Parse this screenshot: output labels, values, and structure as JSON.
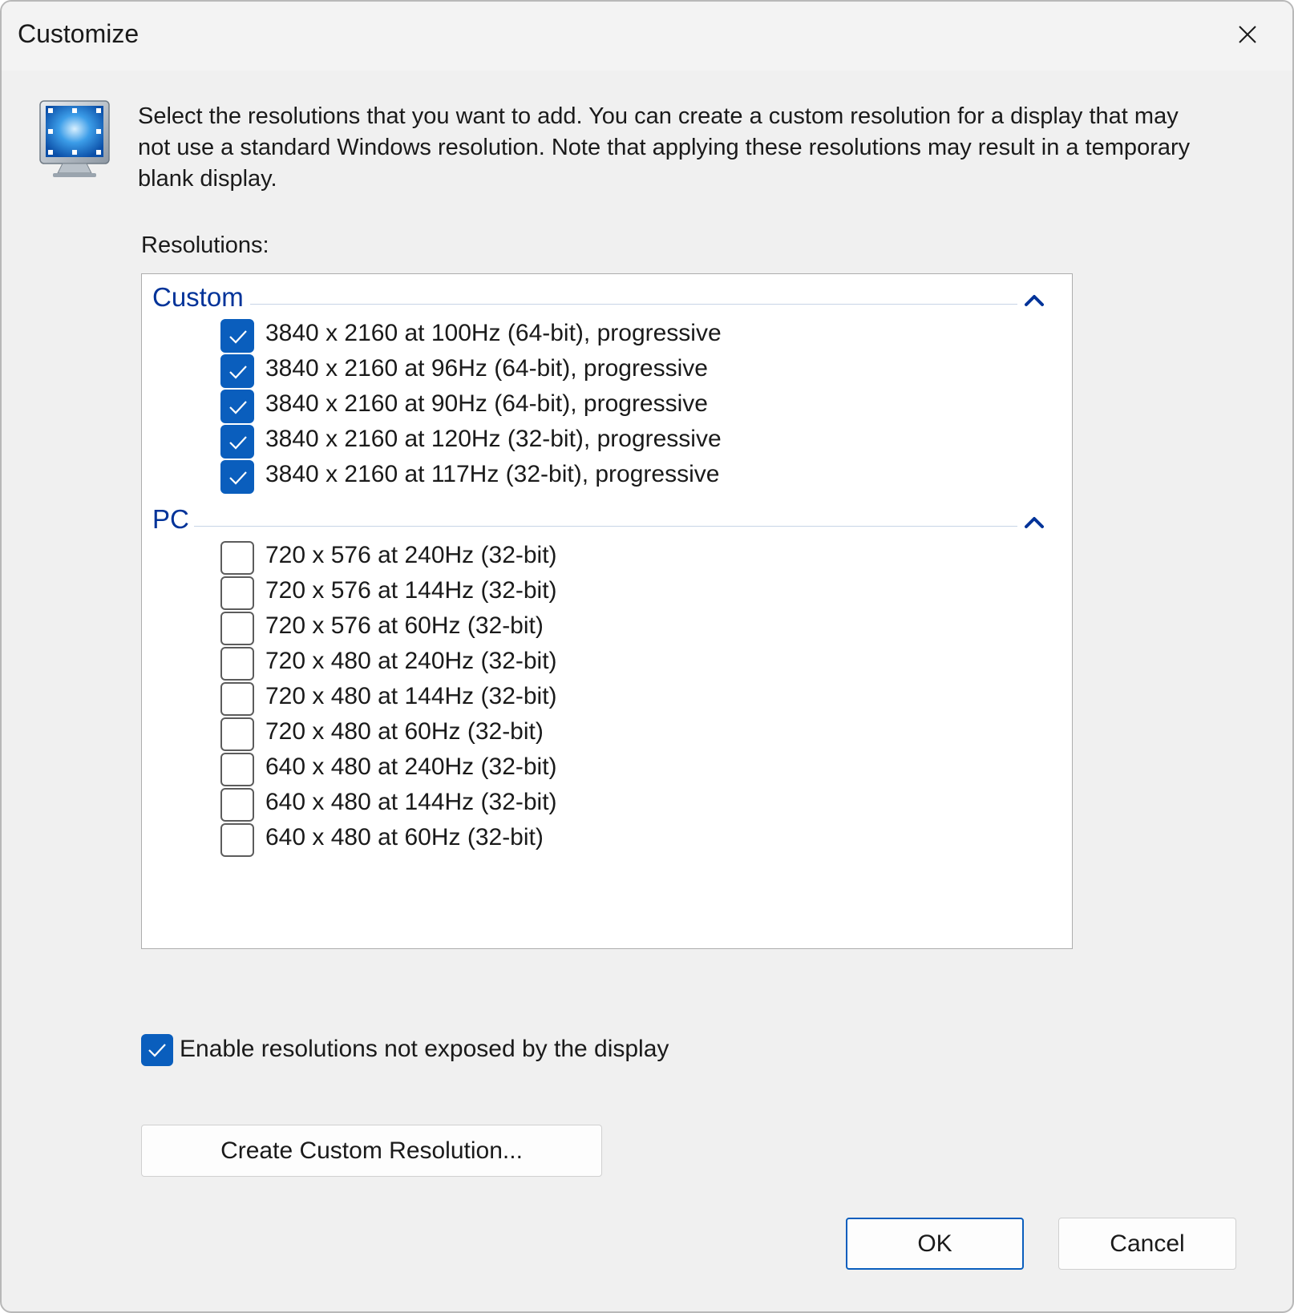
{
  "window": {
    "title": "Customize"
  },
  "description": "Select the resolutions that you want to add. You can create a custom resolution for a display that may not use a standard Windows resolution. Note that applying these resolutions may result in a temporary blank display.",
  "resolutions_label": "Resolutions:",
  "groups": [
    {
      "title": "Custom",
      "items": [
        {
          "label": "3840 x 2160 at 100Hz (64-bit), progressive",
          "checked": true
        },
        {
          "label": "3840 x 2160 at 96Hz (64-bit), progressive",
          "checked": true
        },
        {
          "label": "3840 x 2160 at 90Hz (64-bit), progressive",
          "checked": true
        },
        {
          "label": "3840 x 2160 at 120Hz (32-bit), progressive",
          "checked": true
        },
        {
          "label": "3840 x 2160 at 117Hz (32-bit), progressive",
          "checked": true
        }
      ]
    },
    {
      "title": "PC",
      "items": [
        {
          "label": "720 x 576 at 240Hz (32-bit)",
          "checked": false
        },
        {
          "label": "720 x 576 at 144Hz (32-bit)",
          "checked": false
        },
        {
          "label": "720 x 576 at 60Hz (32-bit)",
          "checked": false
        },
        {
          "label": "720 x 480 at 240Hz (32-bit)",
          "checked": false
        },
        {
          "label": "720 x 480 at 144Hz (32-bit)",
          "checked": false
        },
        {
          "label": "720 x 480 at 60Hz (32-bit)",
          "checked": false
        },
        {
          "label": "640 x 480 at 240Hz (32-bit)",
          "checked": false
        },
        {
          "label": "640 x 480 at 144Hz (32-bit)",
          "checked": false
        },
        {
          "label": "640 x 480 at 60Hz (32-bit)",
          "checked": false
        }
      ]
    }
  ],
  "enable_option": {
    "label": "Enable resolutions not exposed by the display",
    "checked": true
  },
  "buttons": {
    "create": "Create Custom Resolution...",
    "ok": "OK",
    "cancel": "Cancel"
  },
  "colors": {
    "accent": "#0a5ebd",
    "group_title": "#003399",
    "delete": "#d92b2b",
    "edit": "#8bb33a"
  },
  "icons": {
    "close": "close-icon",
    "monitor": "monitor-icon",
    "collapse": "chevron-up-icon",
    "edit": "pencil-icon",
    "delete": "delete-x-icon",
    "check": "checkmark-icon"
  }
}
